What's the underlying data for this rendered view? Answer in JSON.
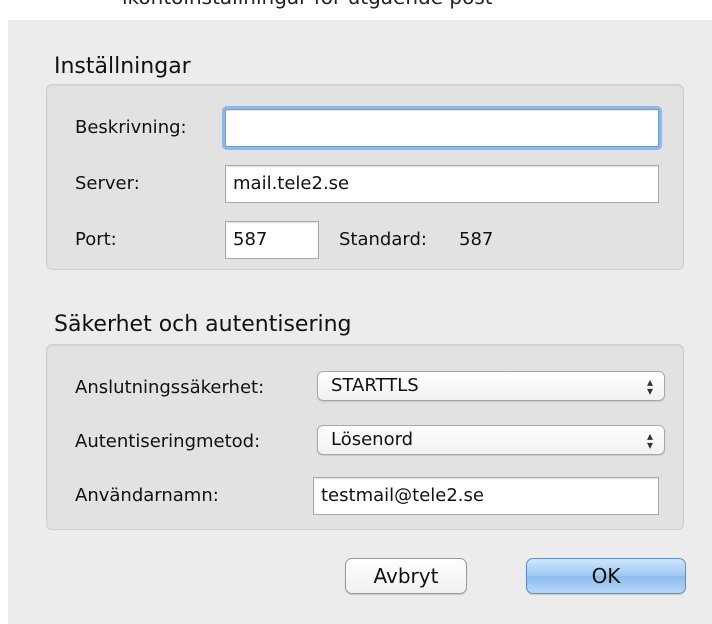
{
  "top_cut_text": "ikontoinställningar för utgående post",
  "settings_section": {
    "title": "Inställningar",
    "description_label": "Beskrivning:",
    "description_value": "",
    "server_label": "Server:",
    "server_value": "mail.tele2.se",
    "port_label": "Port:",
    "port_value": "587",
    "standard_label": "Standard:",
    "standard_value": "587"
  },
  "security_section": {
    "title": "Säkerhet och autentisering",
    "connection_security_label": "Anslutningssäkerhet:",
    "connection_security_value": "STARTTLS",
    "auth_method_label": "Autentiseringmetod:",
    "auth_method_value": "Lösenord",
    "username_label": "Användarnamn:",
    "username_value": "testmail@tele2.se"
  },
  "buttons": {
    "cancel_label": "Avbryt",
    "ok_label": "OK"
  }
}
